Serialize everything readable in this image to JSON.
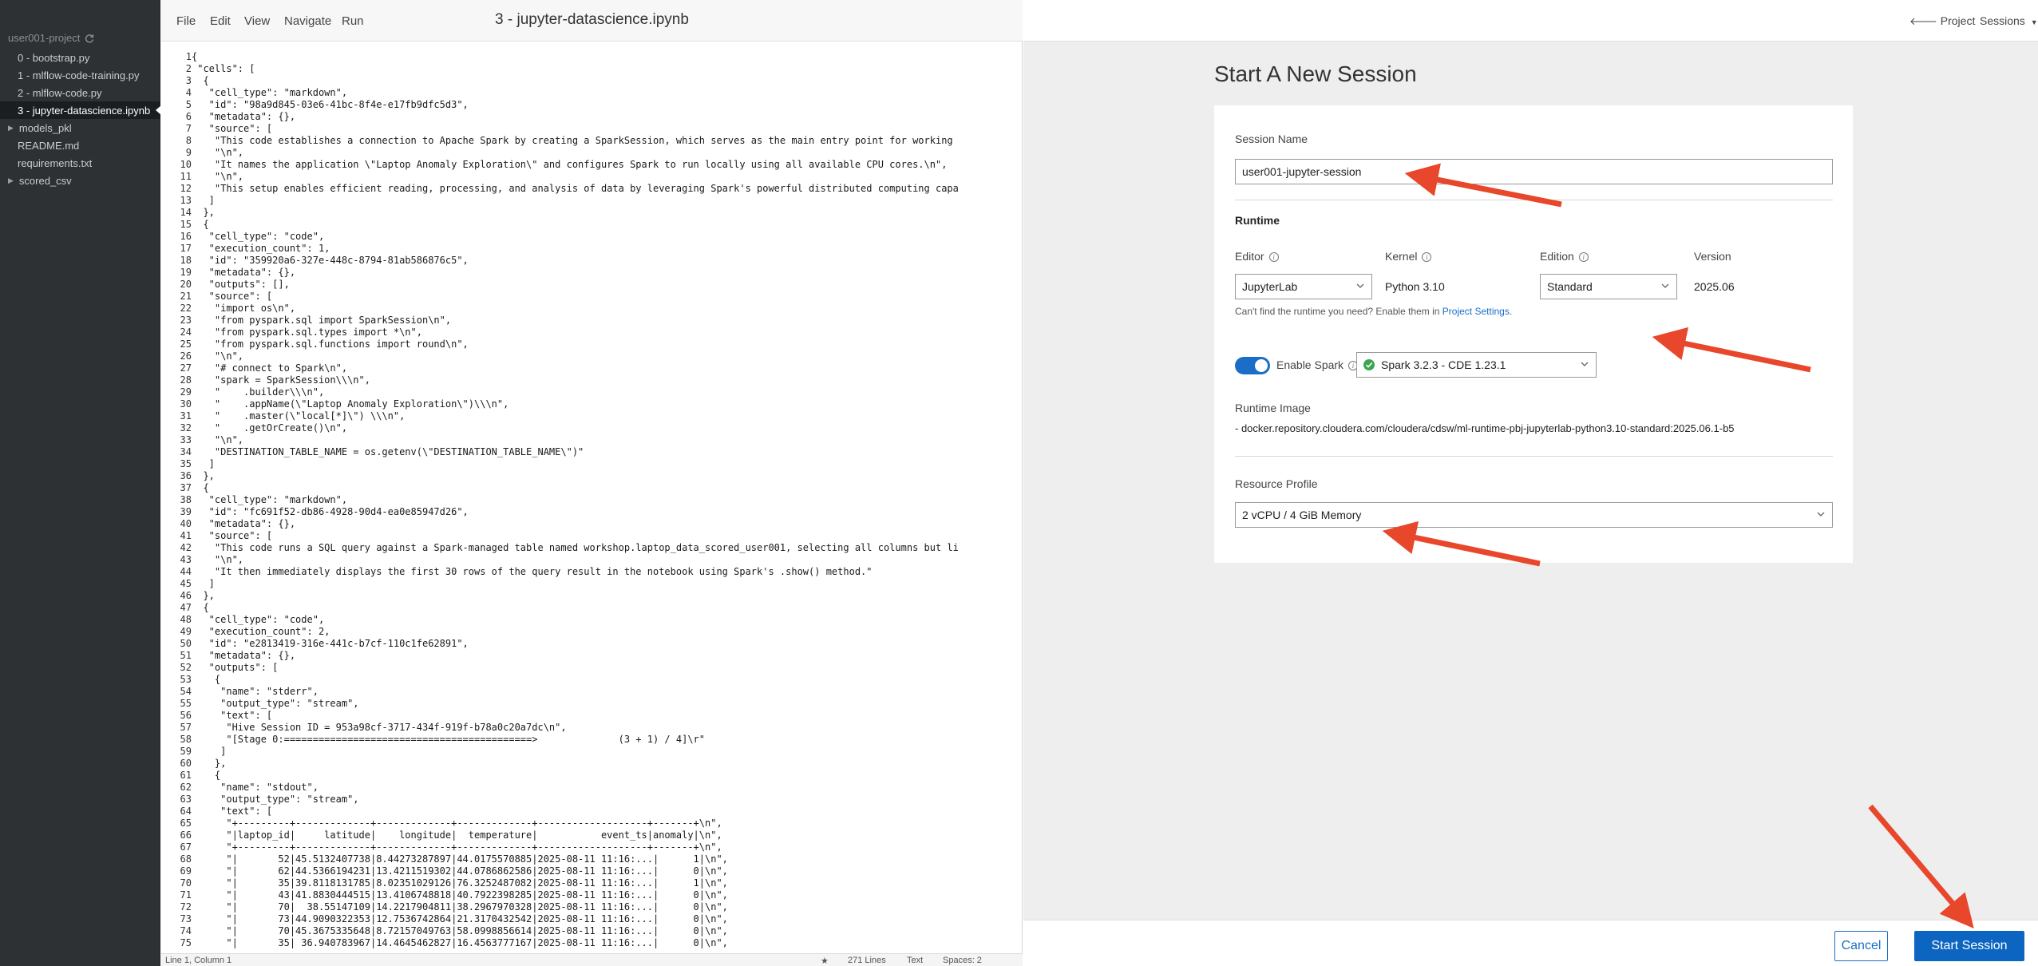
{
  "sidebar": {
    "project_name": "user001-project",
    "items": [
      {
        "label": "0 - bootstrap.py",
        "type": "file"
      },
      {
        "label": "1 - mlflow-code-training.py",
        "type": "file"
      },
      {
        "label": "2 - mlflow-code.py",
        "type": "file"
      },
      {
        "label": "3 - jupyter-datascience.ipynb",
        "type": "file",
        "active": true
      },
      {
        "label": "models_pkl",
        "type": "folder"
      },
      {
        "label": "README.md",
        "type": "file"
      },
      {
        "label": "requirements.txt",
        "type": "file"
      },
      {
        "label": "scored_csv",
        "type": "folder"
      }
    ]
  },
  "editor": {
    "menu": [
      "File",
      "Edit",
      "View",
      "Navigate",
      "Run"
    ],
    "file_title": "3 - jupyter-datascience.ipynb",
    "lines": [
      "{",
      " \"cells\": [",
      "  {",
      "   \"cell_type\": \"markdown\",",
      "   \"id\": \"98a9d845-03e6-41bc-8f4e-e17fb9dfc5d3\",",
      "   \"metadata\": {},",
      "   \"source\": [",
      "    \"This code establishes a connection to Apache Spark by creating a SparkSession, which serves as the main entry point for working",
      "    \"\\n\",",
      "    \"It names the application \\\"Laptop Anomaly Exploration\\\" and configures Spark to run locally using all available CPU cores.\\n\",",
      "    \"\\n\",",
      "    \"This setup enables efficient reading, processing, and analysis of data by leveraging Spark's powerful distributed computing capa",
      "   ]",
      "  },",
      "  {",
      "   \"cell_type\": \"code\",",
      "   \"execution_count\": 1,",
      "   \"id\": \"359920a6-327e-448c-8794-81ab586876c5\",",
      "   \"metadata\": {},",
      "   \"outputs\": [],",
      "   \"source\": [",
      "    \"import os\\n\",",
      "    \"from pyspark.sql import SparkSession\\n\",",
      "    \"from pyspark.sql.types import *\\n\",",
      "    \"from pyspark.sql.functions import round\\n\",",
      "    \"\\n\",",
      "    \"# connect to Spark\\n\",",
      "    \"spark = SparkSession\\\\\\n\",",
      "    \"    .builder\\\\\\n\",",
      "    \"    .appName(\\\"Laptop Anomaly Exploration\\\")\\\\\\n\",",
      "    \"    .master(\\\"local[*]\\\") \\\\\\n\",",
      "    \"    .getOrCreate()\\n\",",
      "    \"\\n\",",
      "    \"DESTINATION_TABLE_NAME = os.getenv(\\\"DESTINATION_TABLE_NAME\\\")\"",
      "   ]",
      "  },",
      "  {",
      "   \"cell_type\": \"markdown\",",
      "   \"id\": \"fc691f52-db86-4928-90d4-ea0e85947d26\",",
      "   \"metadata\": {},",
      "   \"source\": [",
      "    \"This code runs a SQL query against a Spark-managed table named workshop.laptop_data_scored_user001, selecting all columns but li",
      "    \"\\n\",",
      "    \"It then immediately displays the first 30 rows of the query result in the notebook using Spark's .show() method.\"",
      "   ]",
      "  },",
      "  {",
      "   \"cell_type\": \"code\",",
      "   \"execution_count\": 2,",
      "   \"id\": \"e2813419-316e-441c-b7cf-110c1fe62891\",",
      "   \"metadata\": {},",
      "   \"outputs\": [",
      "    {",
      "     \"name\": \"stderr\",",
      "     \"output_type\": \"stream\",",
      "     \"text\": [",
      "      \"Hive Session ID = 953a98cf-3717-434f-919f-b78a0c20a7dc\\n\",",
      "      \"[Stage 0:===========================================>              (3 + 1) / 4]\\r\"",
      "     ]",
      "    },",
      "    {",
      "     \"name\": \"stdout\",",
      "     \"output_type\": \"stream\",",
      "     \"text\": [",
      "      \"+---------+-------------+-------------+-------------+-------------------+-------+\\n\",",
      "      \"|laptop_id|     latitude|    longitude|  temperature|           event_ts|anomaly|\\n\",",
      "      \"+---------+-------------+-------------+-------------+-------------------+-------+\\n\",",
      "      \"|       52|45.5132407738|8.44273287897|44.0175570885|2025-08-11 11:16:...|      1|\\n\",",
      "      \"|       62|44.5366194231|13.4211519302|44.0786862586|2025-08-11 11:16:...|      0|\\n\",",
      "      \"|       35|39.8118131785|8.02351029126|76.3252487082|2025-08-11 11:16:...|      1|\\n\",",
      "      \"|       43|41.8830444515|13.4106748818|40.7922398285|2025-08-11 11:16:...|      0|\\n\",",
      "      \"|       70|  38.55147109|14.2217904811|38.2967970328|2025-08-11 11:16:...|      0|\\n\",",
      "      \"|       73|44.9090322353|12.7536742864|21.3170432542|2025-08-11 11:16:...|      0|\\n\",",
      "      \"|       70|45.3675335648|8.72157049763|58.0998856614|2025-08-11 11:16:...|      0|\\n\",",
      "      \"|       35| 36.940783967|14.4645462827|16.4563777167|2025-08-11 11:16:...|      0|\\n\","
    ],
    "status": {
      "position": "Line 1, Column 1",
      "star": "★",
      "lines_count": "271 Lines",
      "mode": "Text",
      "indent": "Spaces: 2"
    }
  },
  "nav": {
    "project_label": "Project",
    "sessions_label": "Sessions"
  },
  "session_form": {
    "page_title": "Start A New Session",
    "session_name_label": "Session Name",
    "session_name_value": "user001-jupyter-session",
    "runtime_heading": "Runtime",
    "editor_label": "Editor",
    "editor_value": "JupyterLab",
    "kernel_label": "Kernel",
    "kernel_value": "Python 3.10",
    "edition_label": "Edition",
    "edition_value": "Standard",
    "version_label": "Version",
    "version_value": "2025.06",
    "runtime_help_prefix": "Can't find the runtime you need? Enable them in ",
    "runtime_help_link": "Project Settings",
    "runtime_help_suffix": ".",
    "enable_spark_label": "Enable Spark",
    "enable_spark_on": true,
    "spark_value": "Spark 3.2.3 - CDE 1.23.1",
    "runtime_image_label": "Runtime Image",
    "runtime_image_value": "- docker.repository.cloudera.com/cloudera/cdsw/ml-runtime-pbj-jupyterlab-python3.10-standard:2025.06.1-b5",
    "resource_profile_label": "Resource Profile",
    "resource_profile_value": "2 vCPU / 4 GiB Memory"
  },
  "footer": {
    "cancel_label": "Cancel",
    "start_label": "Start Session"
  },
  "colors": {
    "accent": "#0d65c2",
    "arrow": "#e8472b",
    "sidebar_bg": "#2d3134"
  }
}
